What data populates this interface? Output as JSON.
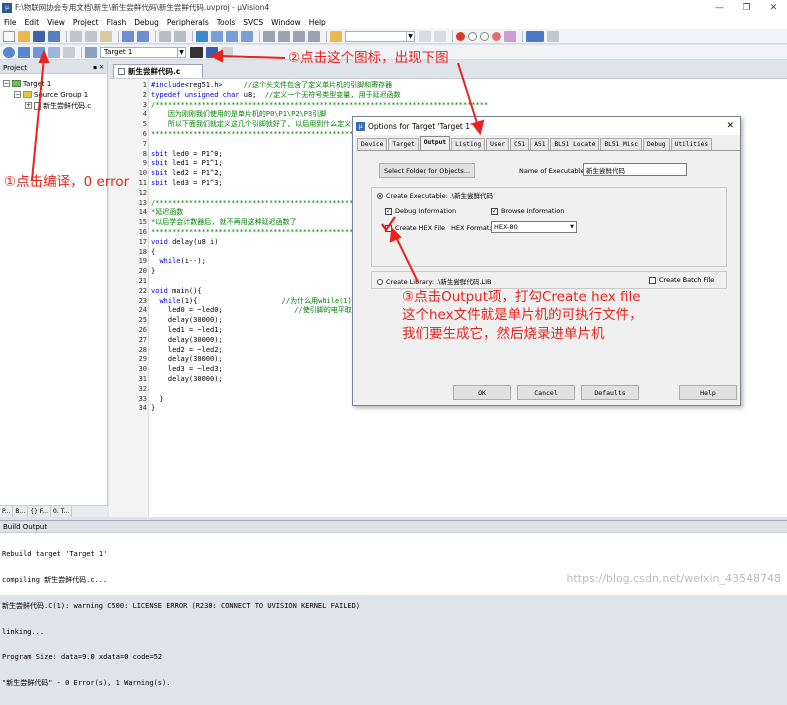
{
  "window": {
    "title": "F:\\物联网协会专用文档\\新生\\新生尝鲜代码\\新生尝鲜代码.uvproj - µVision4",
    "app_icon": "uv-app-icon",
    "controls": [
      "—",
      "❐",
      "✕"
    ]
  },
  "menu": [
    "File",
    "Edit",
    "View",
    "Project",
    "Flash",
    "Debug",
    "Peripherals",
    "Tools",
    "SVCS",
    "Window",
    "Help"
  ],
  "toolbar": {
    "target_combo": "Target 1"
  },
  "project_pane": {
    "title": "Project",
    "pin": "▪ ✕",
    "tree": [
      "Target 1",
      "Source Group 1",
      "新生尝鲜代码.c"
    ],
    "bottom_tabs": [
      "P...",
      "B...",
      "{} F...",
      "0. T..."
    ]
  },
  "editor": {
    "tab": "新生尝鲜代码.c",
    "lines": [
      {
        "n": "1",
        "parts": [
          {
            "c": "dir",
            "t": "#include"
          },
          {
            "c": "",
            "t": "<reg51.h>     "
          },
          {
            "c": "cm",
            "t": "//这个头文件包含了定义单片机的引脚和寄存器"
          }
        ]
      },
      {
        "n": "2",
        "parts": [
          {
            "c": "kw",
            "t": "typedef unsigned char"
          },
          {
            "c": "",
            "t": " u8;  "
          },
          {
            "c": "cm",
            "t": "//定义一个无符号类型变量, 用于延迟函数"
          }
        ]
      },
      {
        "n": "3",
        "parts": [
          {
            "c": "cm",
            "t": "/*******************************************************************************"
          }
        ]
      },
      {
        "n": "4",
        "parts": [
          {
            "c": "cm",
            "t": "    因为刚刚我们使用的是单片机的P0\\P1\\P2\\P3引脚"
          }
        ]
      },
      {
        "n": "5",
        "parts": [
          {
            "c": "cm",
            "t": "    所以下面我们就定义这几个引脚就好了, 以后用到什么定义什么"
          }
        ]
      },
      {
        "n": "6",
        "parts": [
          {
            "c": "cm",
            "t": "*******************************************************************************/"
          }
        ]
      },
      {
        "n": "7",
        "parts": [
          {
            "c": "",
            "t": ""
          }
        ]
      },
      {
        "n": "8",
        "parts": [
          {
            "c": "kw",
            "t": "sbit"
          },
          {
            "c": "",
            "t": " led0 = P1^0;"
          }
        ]
      },
      {
        "n": "9",
        "parts": [
          {
            "c": "kw",
            "t": "sbit"
          },
          {
            "c": "",
            "t": " led1 = P1^1;"
          }
        ]
      },
      {
        "n": "10",
        "parts": [
          {
            "c": "kw",
            "t": "sbit"
          },
          {
            "c": "",
            "t": " led2 = P1^2;"
          }
        ]
      },
      {
        "n": "11",
        "parts": [
          {
            "c": "kw",
            "t": "sbit"
          },
          {
            "c": "",
            "t": " led3 = P1^3;"
          }
        ]
      },
      {
        "n": "12",
        "parts": [
          {
            "c": "",
            "t": ""
          }
        ]
      },
      {
        "n": "13",
        "parts": [
          {
            "c": "cm",
            "t": "/*******************************************************************************"
          }
        ]
      },
      {
        "n": "14",
        "parts": [
          {
            "c": "cm",
            "t": "*延迟函数"
          }
        ]
      },
      {
        "n": "15",
        "parts": [
          {
            "c": "cm",
            "t": "*以后学会计数器后, 就不再用这种延迟函数了"
          }
        ]
      },
      {
        "n": "16",
        "parts": [
          {
            "c": "cm",
            "t": "*******************************************************************************/"
          }
        ]
      },
      {
        "n": "17",
        "parts": [
          {
            "c": "kw",
            "t": "void"
          },
          {
            "c": "",
            "t": " delay(u8 i)"
          }
        ]
      },
      {
        "n": "18",
        "parts": [
          {
            "c": "",
            "t": "{"
          }
        ]
      },
      {
        "n": "19",
        "parts": [
          {
            "c": "",
            "t": "  "
          },
          {
            "c": "kw",
            "t": "while"
          },
          {
            "c": "",
            "t": "(i--);"
          }
        ]
      },
      {
        "n": "20",
        "parts": [
          {
            "c": "",
            "t": "}"
          }
        ]
      },
      {
        "n": "21",
        "parts": [
          {
            "c": "",
            "t": ""
          }
        ]
      },
      {
        "n": "22",
        "parts": [
          {
            "c": "kw",
            "t": "void"
          },
          {
            "c": "",
            "t": " main(){"
          }
        ]
      },
      {
        "n": "23",
        "parts": [
          {
            "c": "",
            "t": "  "
          },
          {
            "c": "kw",
            "t": "while"
          },
          {
            "c": "",
            "t": "(1){                    "
          },
          {
            "c": "cm",
            "t": "//为什么用while(1)呢, 因为这个是单片机的一个循环, 如果不加这个, 单片机执行一次就停了"
          }
        ]
      },
      {
        "n": "24",
        "parts": [
          {
            "c": "",
            "t": "    led0 = ~led0;                 "
          },
          {
            "c": "cm",
            "t": "//使引脚的电平取反, 原来是高电平的话就变成低电平, 原来是低电平的话就变成高电平 led0=0"
          }
        ]
      },
      {
        "n": "25",
        "parts": [
          {
            "c": "",
            "t": "    delay(30000);"
          }
        ]
      },
      {
        "n": "26",
        "parts": [
          {
            "c": "",
            "t": "    led1 = ~led1;"
          }
        ]
      },
      {
        "n": "27",
        "parts": [
          {
            "c": "",
            "t": "    delay(30000);"
          }
        ]
      },
      {
        "n": "28",
        "parts": [
          {
            "c": "",
            "t": "    led2 = ~led2;"
          }
        ]
      },
      {
        "n": "29",
        "parts": [
          {
            "c": "",
            "t": "    delay(30000);"
          }
        ]
      },
      {
        "n": "30",
        "parts": [
          {
            "c": "",
            "t": "    led3 = ~led3;"
          }
        ]
      },
      {
        "n": "31",
        "parts": [
          {
            "c": "",
            "t": "    delay(30000);"
          }
        ]
      },
      {
        "n": "32",
        "parts": [
          {
            "c": "",
            "t": ""
          }
        ]
      },
      {
        "n": "33",
        "parts": [
          {
            "c": "",
            "t": "  }"
          }
        ]
      },
      {
        "n": "34",
        "parts": [
          {
            "c": "",
            "t": "}"
          }
        ]
      }
    ]
  },
  "build_output": {
    "title": "Build Output",
    "lines": [
      "Rebuild target 'Target 1'",
      "compiling 新生尝鲜代码.c...",
      "新生尝鲜代码.C(1): warning C500: LICENSE ERROR (R230: CONNECT TO UVISION KERNEL FAILED)",
      "linking...",
      "Program Size: data=9.0 xdata=0 code=52",
      "\"新生尝鲜代码\" - 0 Error(s), 1 Warning(s)."
    ]
  },
  "watermark": "https://blog.csdn.net/weixin_43548748",
  "dialog": {
    "title": "Options for Target 'Target 1'",
    "close": "✕",
    "tabs": [
      "Device",
      "Target",
      "Output",
      "Listing",
      "User",
      "C51",
      "A51",
      "BL51 Locate",
      "BL51 Misc",
      "Debug",
      "Utilities"
    ],
    "active_tab": "Output",
    "select_folder_button": "Select Folder for Objects...",
    "name_of_executable_label": "Name of Executable:",
    "name_of_executable_value": "新生尝鲜代码",
    "create_executable_label": "Create Executable:  .\\新生尝鲜代码",
    "debug_information_label": "Debug Information",
    "browse_information_label": "Browse Information",
    "create_hex_label": "Create HEX File",
    "hex_format_label": "HEX Format:",
    "hex_format_value": "HEX-80",
    "create_library_label": "Create Library:  .\\新生尝鲜代码.LIB",
    "create_batch_label": "Create Batch File",
    "buttons": {
      "ok": "OK",
      "cancel": "Cancel",
      "defaults": "Defaults",
      "help": "Help"
    }
  },
  "annotations": {
    "step1": "①点击编译，0 error",
    "step2": "②点击这个图标，出现下图",
    "step3_line1": "③点击Output项，打勾Create hex file",
    "step3_line2": "这个hex文件就是单片机的可执行文件，",
    "step3_line3": "我们要生成它，然后烧录进单片机",
    "color": "#e8231f"
  }
}
